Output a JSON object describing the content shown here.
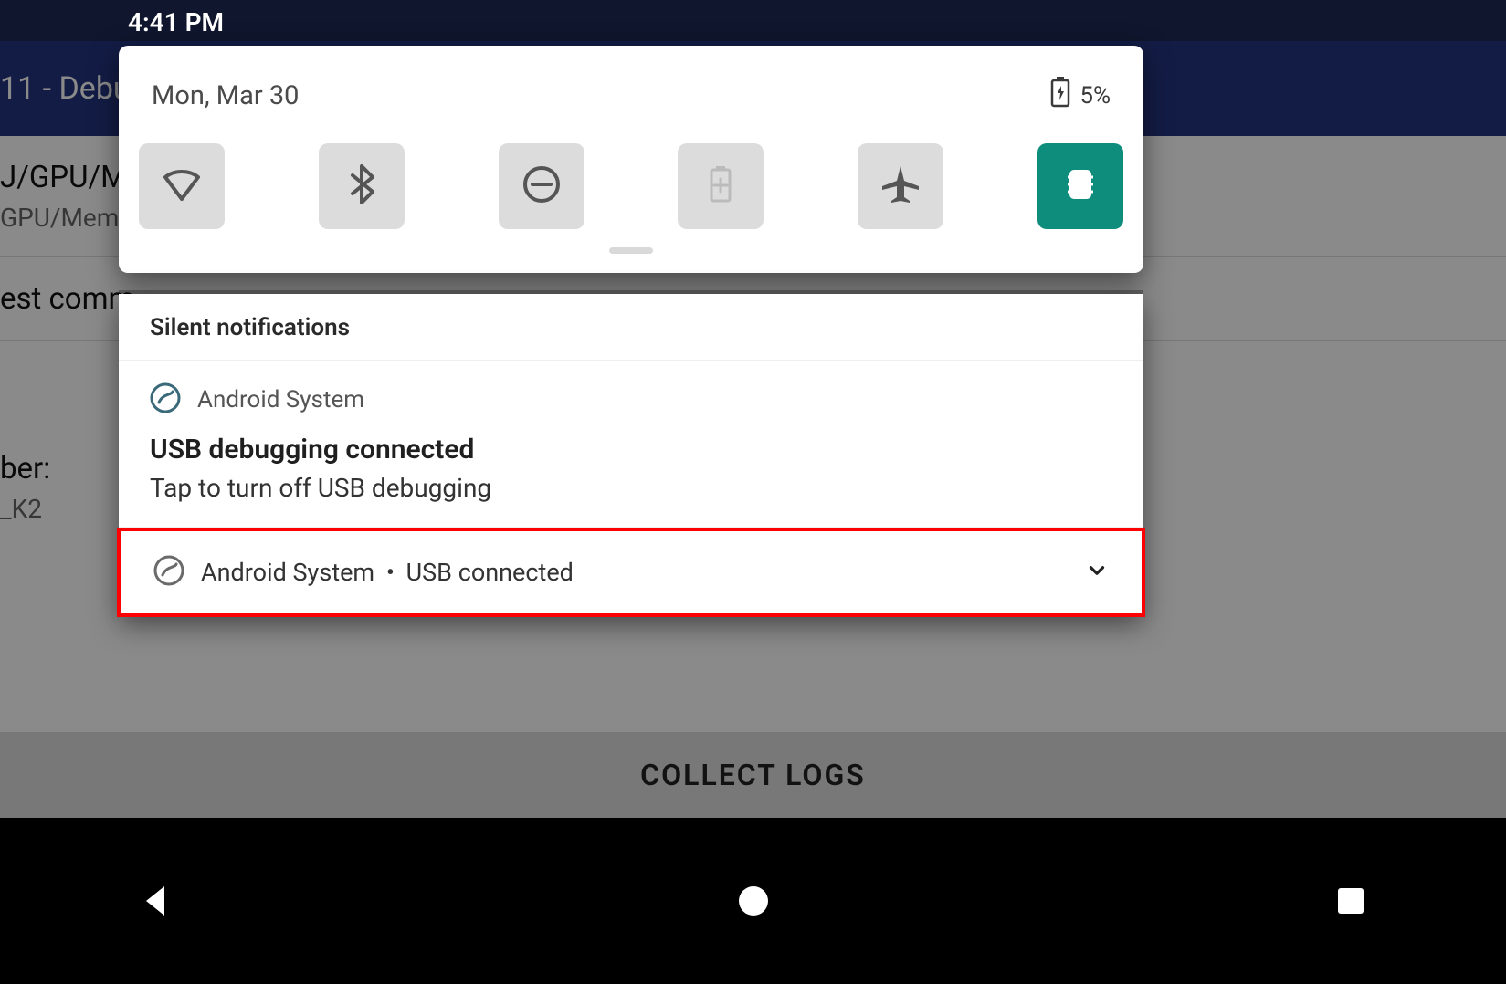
{
  "status": {
    "time": "4:41 PM"
  },
  "quick_settings": {
    "date": "Mon, Mar 30",
    "battery_pct": "5%"
  },
  "silent_header": "Silent notifications",
  "notifications": [
    {
      "app": "Android System",
      "title": "USB debugging connected",
      "text": "Tap to turn off USB debugging"
    },
    {
      "app": "Android System",
      "summary": "USB connected"
    }
  ],
  "background_app": {
    "appbar_title": "11 - Debu",
    "row1_title": "J/GPU/M",
    "row1_sub": "GPU/Mem",
    "row2_title": "est comm",
    "row3_label": "ber:",
    "row3_value": "_K2",
    "collect_button": "COLLECT LOGS"
  }
}
